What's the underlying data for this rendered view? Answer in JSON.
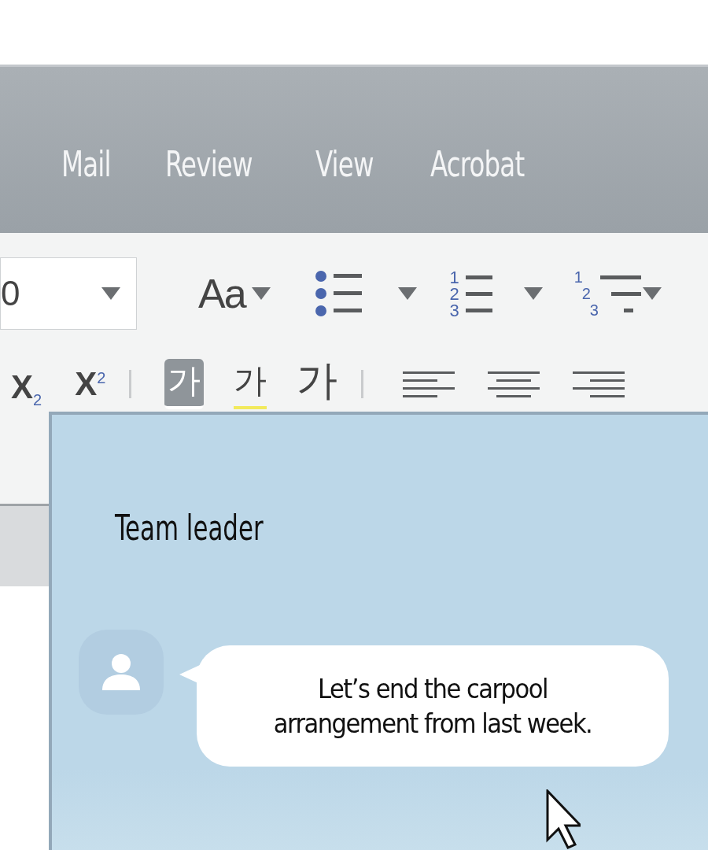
{
  "ribbon_tabs": [
    {
      "label": "Mail"
    },
    {
      "label": "Review"
    },
    {
      "label": "View"
    },
    {
      "label": "Acrobat"
    }
  ],
  "toolbar": {
    "font_size": {
      "value": "0"
    },
    "change_case": {
      "label": "Aa"
    },
    "numbered_list": {
      "digits": [
        "1",
        "2",
        "3"
      ]
    },
    "multilevel_list": {
      "digits": [
        "1",
        "2",
        "3"
      ]
    },
    "script_buttons": [
      {
        "kind": "subscript",
        "label": "X$_{2}$"
      },
      {
        "kind": "superscript",
        "label": "X$^{2}$"
      }
    ],
    "korean_buttons": [
      {
        "kind": "font-color",
        "label": "가",
        "color": "#ffffff"
      },
      {
        "kind": "highlight",
        "label": "가",
        "color": "#f2ea5c"
      },
      {
        "kind": "grow",
        "label": "가"
      }
    ]
  },
  "chat": {
    "title": "Team leader",
    "messages": [
      {
        "text": "Let’s end the carpool arrangement from last week."
      }
    ]
  }
}
